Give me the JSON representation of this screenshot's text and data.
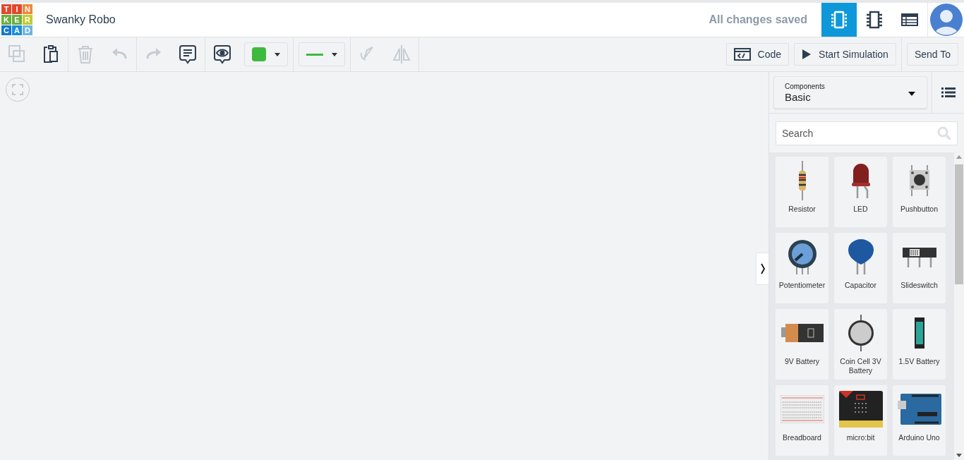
{
  "logo": {
    "letters": [
      {
        "char": "T",
        "color": "#e2482d"
      },
      {
        "char": "I",
        "color": "#e2482d"
      },
      {
        "char": "N",
        "color": "#f1863a"
      },
      {
        "char": "K",
        "color": "#6cae3e"
      },
      {
        "char": "E",
        "color": "#6cae3e"
      },
      {
        "char": "R",
        "color": "#c1cc2f"
      },
      {
        "char": "C",
        "color": "#1477d4"
      },
      {
        "char": "A",
        "color": "#1a8fd6"
      },
      {
        "char": "D",
        "color": "#6fb5e2"
      }
    ]
  },
  "project_title": "Swanky Robo",
  "save_status": "All changes saved",
  "view_tabs": [
    {
      "kind": "circuit",
      "selected": true
    },
    {
      "kind": "schematic",
      "selected": false
    },
    {
      "kind": "list",
      "selected": false
    }
  ],
  "toolbar": [
    {
      "kind": "copy",
      "disabled": true
    },
    {
      "kind": "paste",
      "disabled": false
    },
    {
      "kind": "delete",
      "disabled": true
    },
    {
      "kind": "undo",
      "disabled": true
    },
    {
      "kind": "redo",
      "disabled": true
    },
    {
      "kind": "note",
      "disabled": false
    },
    {
      "kind": "notes-visibility",
      "disabled": false
    },
    {
      "kind": "color",
      "disabled": false,
      "color": "#3dba3d"
    },
    {
      "kind": "wire",
      "disabled": false,
      "color": "#3dba3d"
    },
    {
      "kind": "rotate",
      "disabled": true
    },
    {
      "kind": "flip",
      "disabled": true
    }
  ],
  "actions": [
    {
      "kind": "code",
      "label": "Code"
    },
    {
      "kind": "simulate",
      "label": "Start Simulation"
    },
    {
      "kind": "send",
      "label": "Send To"
    }
  ],
  "panel": {
    "dropdown_label": "Components",
    "dropdown_value": "Basic",
    "search_placeholder": "Search",
    "components": [
      {
        "kind": "resistor",
        "label": "Resistor"
      },
      {
        "kind": "led",
        "label": "LED"
      },
      {
        "kind": "pushbutton",
        "label": "Pushbutton"
      },
      {
        "kind": "potentiometer",
        "label": "Potentiometer"
      },
      {
        "kind": "capacitor",
        "label": "Capacitor"
      },
      {
        "kind": "slideswitch",
        "label": "Slideswitch"
      },
      {
        "kind": "battery9v",
        "label": "9V Battery"
      },
      {
        "kind": "coincell",
        "label": "Coin Cell 3V Battery"
      },
      {
        "kind": "battery15",
        "label": "1.5V Battery"
      },
      {
        "kind": "breadboard",
        "label": "Breadboard"
      },
      {
        "kind": "microbit",
        "label": "micro:bit"
      },
      {
        "kind": "arduino",
        "label": "Arduino Uno"
      }
    ]
  }
}
